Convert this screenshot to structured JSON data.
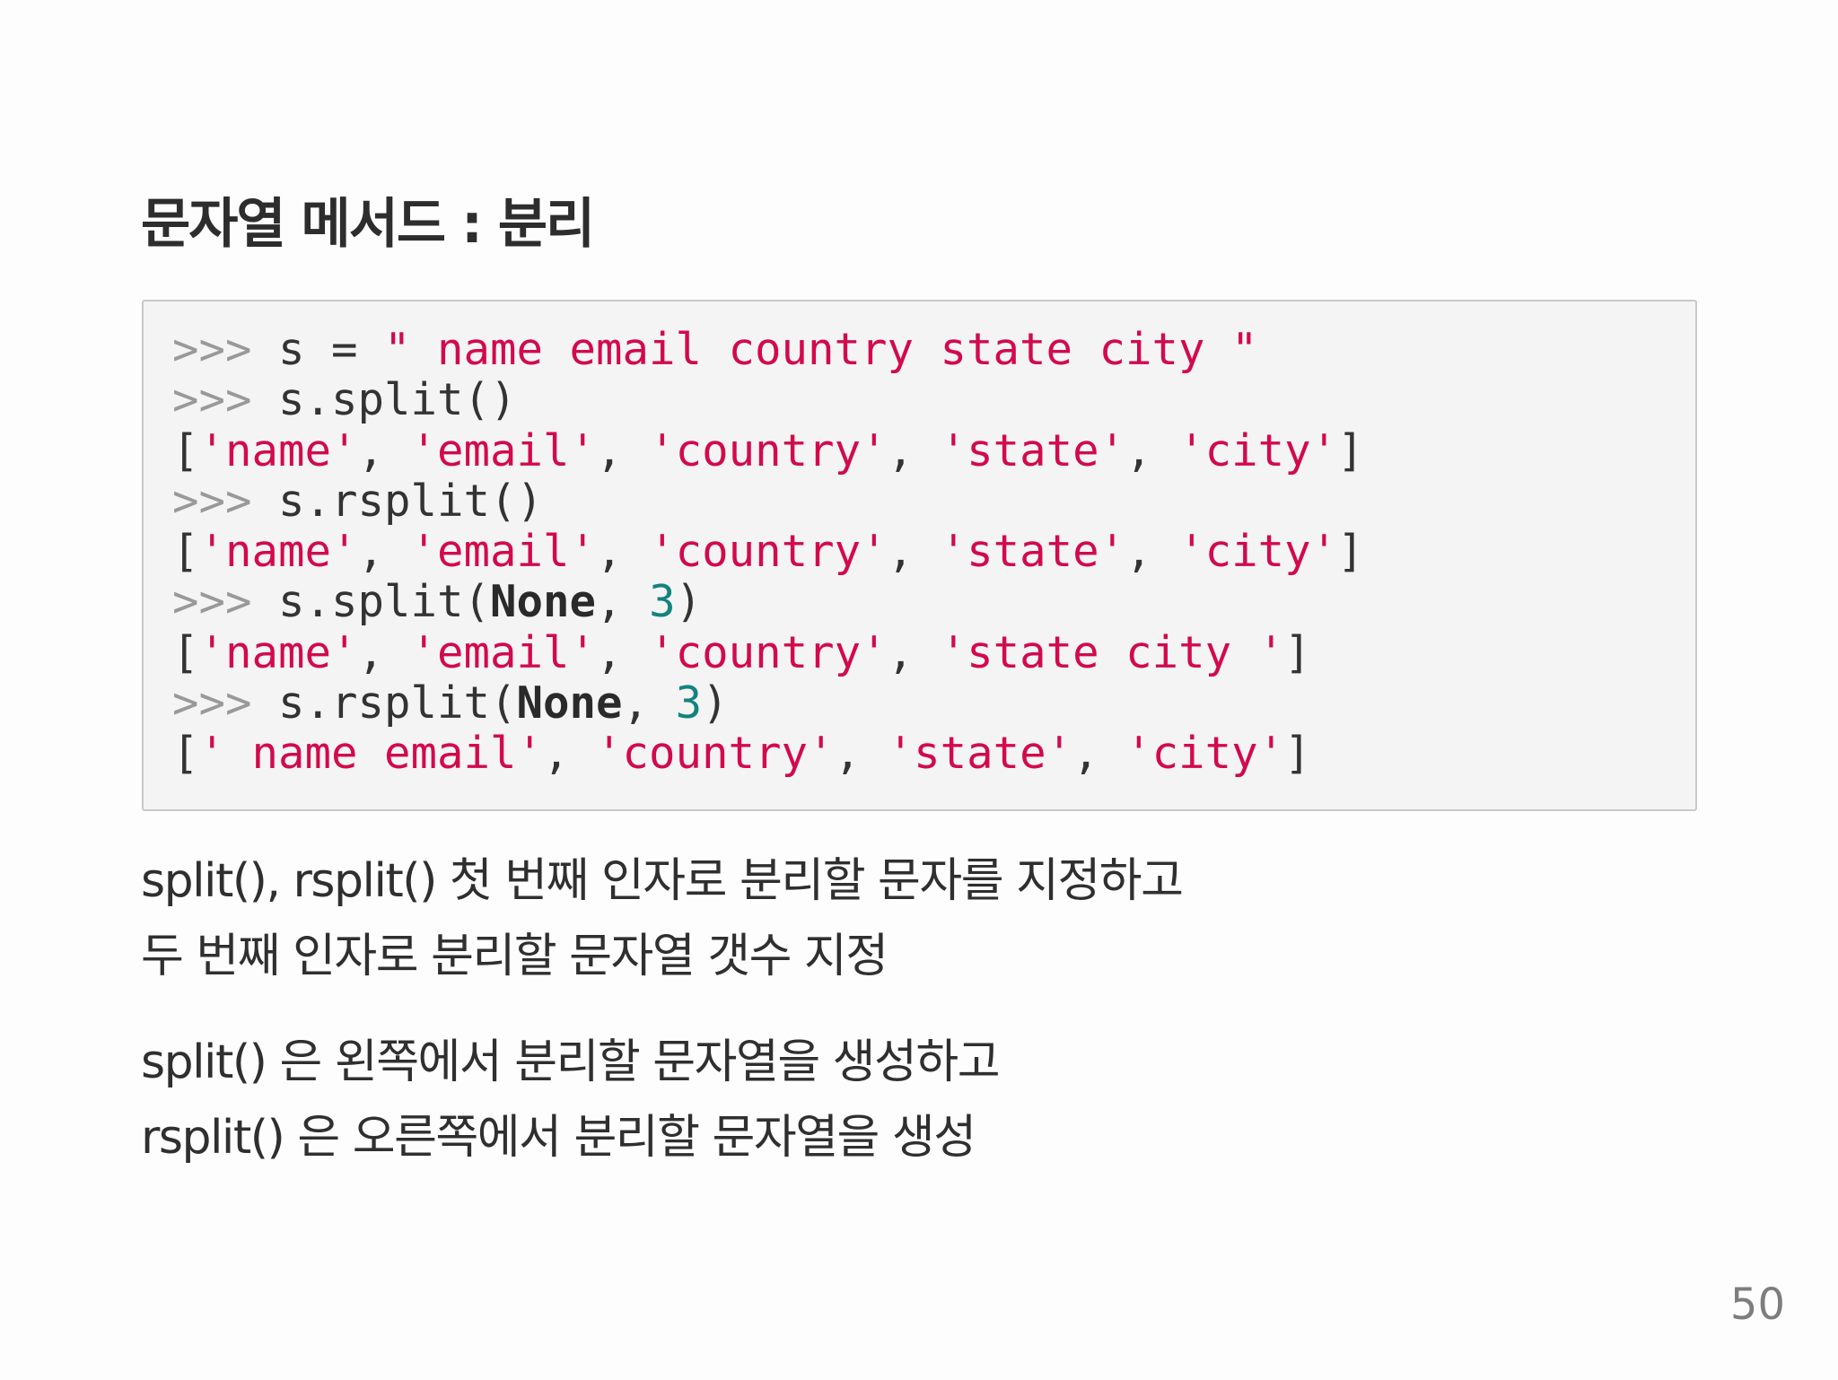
{
  "title": "문자열 메서드 : 분리",
  "code": {
    "prompt": ">>>",
    "lines": [
      {
        "kind": "input",
        "parts": [
          {
            "t": "t",
            "v": " s = "
          },
          {
            "t": "s",
            "v": "\" name email country state city \""
          }
        ]
      },
      {
        "kind": "input",
        "parts": [
          {
            "t": "t",
            "v": " s.split()"
          }
        ]
      },
      {
        "kind": "output",
        "parts": [
          {
            "t": "t",
            "v": "["
          },
          {
            "t": "s",
            "v": "'name'"
          },
          {
            "t": "t",
            "v": ", "
          },
          {
            "t": "s",
            "v": "'email'"
          },
          {
            "t": "t",
            "v": ", "
          },
          {
            "t": "s",
            "v": "'country'"
          },
          {
            "t": "t",
            "v": ", "
          },
          {
            "t": "s",
            "v": "'state'"
          },
          {
            "t": "t",
            "v": ", "
          },
          {
            "t": "s",
            "v": "'city'"
          },
          {
            "t": "t",
            "v": "]"
          }
        ]
      },
      {
        "kind": "input",
        "parts": [
          {
            "t": "t",
            "v": " s.rsplit()"
          }
        ]
      },
      {
        "kind": "output",
        "parts": [
          {
            "t": "t",
            "v": "["
          },
          {
            "t": "s",
            "v": "'name'"
          },
          {
            "t": "t",
            "v": ", "
          },
          {
            "t": "s",
            "v": "'email'"
          },
          {
            "t": "t",
            "v": ", "
          },
          {
            "t": "s",
            "v": "'country'"
          },
          {
            "t": "t",
            "v": ", "
          },
          {
            "t": "s",
            "v": "'state'"
          },
          {
            "t": "t",
            "v": ", "
          },
          {
            "t": "s",
            "v": "'city'"
          },
          {
            "t": "t",
            "v": "]"
          }
        ]
      },
      {
        "kind": "input",
        "parts": [
          {
            "t": "t",
            "v": " s.split("
          },
          {
            "t": "k",
            "v": "None"
          },
          {
            "t": "t",
            "v": ", "
          },
          {
            "t": "n",
            "v": "3"
          },
          {
            "t": "t",
            "v": ")"
          }
        ]
      },
      {
        "kind": "output",
        "parts": [
          {
            "t": "t",
            "v": "["
          },
          {
            "t": "s",
            "v": "'name'"
          },
          {
            "t": "t",
            "v": ", "
          },
          {
            "t": "s",
            "v": "'email'"
          },
          {
            "t": "t",
            "v": ", "
          },
          {
            "t": "s",
            "v": "'country'"
          },
          {
            "t": "t",
            "v": ", "
          },
          {
            "t": "s",
            "v": "'state city '"
          },
          {
            "t": "t",
            "v": "]"
          }
        ]
      },
      {
        "kind": "input",
        "parts": [
          {
            "t": "t",
            "v": " s.rsplit("
          },
          {
            "t": "k",
            "v": "None"
          },
          {
            "t": "t",
            "v": ", "
          },
          {
            "t": "n",
            "v": "3"
          },
          {
            "t": "t",
            "v": ")"
          }
        ]
      },
      {
        "kind": "output",
        "parts": [
          {
            "t": "t",
            "v": "["
          },
          {
            "t": "s",
            "v": "' name email'"
          },
          {
            "t": "t",
            "v": ", "
          },
          {
            "t": "s",
            "v": "'country'"
          },
          {
            "t": "t",
            "v": ", "
          },
          {
            "t": "s",
            "v": "'state'"
          },
          {
            "t": "t",
            "v": ", "
          },
          {
            "t": "s",
            "v": "'city'"
          },
          {
            "t": "t",
            "v": "]"
          }
        ]
      }
    ]
  },
  "paragraphs": [
    {
      "lines": [
        "split(), rsplit() 첫 번째 인자로 분리할 문자를 지정하고",
        "두 번째 인자로 분리할 문자열 갯수 지정"
      ]
    },
    {
      "lines": [
        "split() 은 왼쪽에서 분리할 문자열을 생성하고",
        "rsplit() 은 오른쪽에서 분리할 문자열을 생성"
      ]
    }
  ],
  "page_number": "50",
  "colors": {
    "string": "#d20a4b",
    "number": "#13837f",
    "prompt": "#999999",
    "code_background": "#f4f4f5"
  }
}
